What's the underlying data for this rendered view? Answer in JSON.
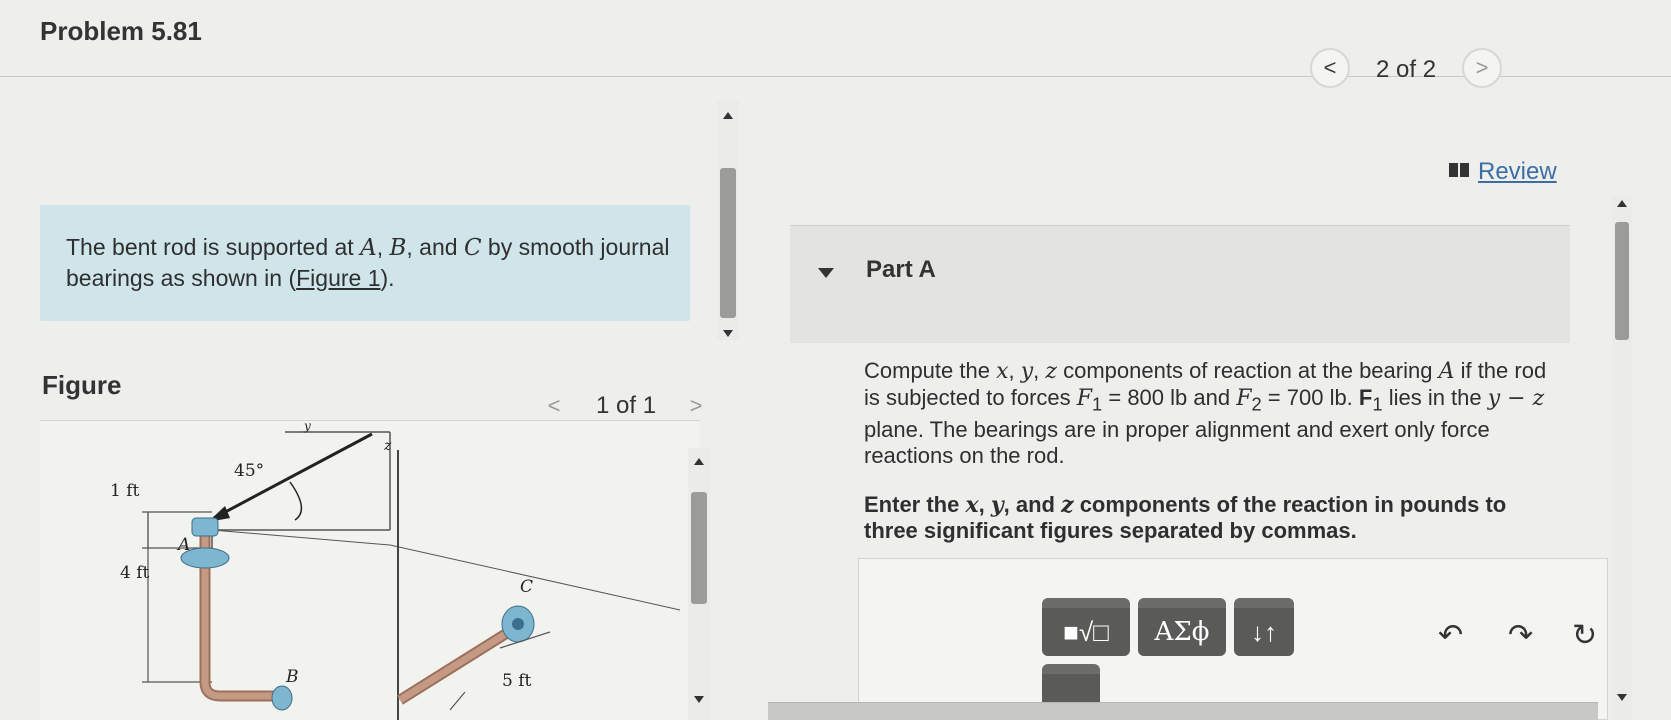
{
  "header": {
    "title": "Problem 5.81",
    "pager": {
      "prev": "<",
      "text": "2 of 2",
      "next": ">"
    },
    "review_label": "Review"
  },
  "intro": {
    "text_before": "The bent rod is supported at ",
    "A": "A",
    "comma1": ", ",
    "B": "B",
    "text_and": ", and ",
    "C": "C",
    "text_after": " by smooth journal bearings as shown in (",
    "figure_link": "Figure 1",
    "text_end": ")."
  },
  "figure": {
    "label": "Figure",
    "pager": {
      "prev": "<",
      "text": "1 of 1",
      "next": ">"
    },
    "labels": {
      "dim_1ft": "1 ft",
      "dim_4ft": "4 ft",
      "angle": "45°",
      "point_a": "A",
      "point_b": "B",
      "point_c": "C",
      "dim_5ft": "5 ft",
      "axis_z": "z",
      "axis_y": "y"
    }
  },
  "part": {
    "label": "Part A",
    "problem": {
      "t1": "Compute the ",
      "x": "x",
      "c1": ", ",
      "y": "y",
      "c2": ", ",
      "z": "z",
      "t2": " components of reaction at the bearing ",
      "A": "A",
      "t3": " if the rod is subjected to forces ",
      "F1": "F",
      "F1sub": "1",
      "t4": " = 800 lb and ",
      "F2": "F",
      "F2sub": "2",
      "t5": " = 700 lb. ",
      "F1b": "F",
      "F1bsub": "1",
      "t6": " lies in the ",
      "plane": "y − z",
      "t7": " plane. The bearings are in proper alignment and exert only force reactions on the rod."
    },
    "instruction": {
      "t1": "Enter the ",
      "x": "x",
      "c1": ", ",
      "y": "y",
      "t2": ", and ",
      "z": "z",
      "t3": " components of the reaction in pounds to three significant figures separated by commas."
    },
    "toolbar": {
      "templates": "■√□",
      "symbols": "ΑΣϕ",
      "vector": "↓↑",
      "undo": "↶",
      "redo": "↷",
      "reset": "↻"
    }
  },
  "colors": {
    "intro_bg": "#cfe5e9",
    "link": "#3b6ea5",
    "tool_btn": "#5a5a58",
    "rod": "#c49a84",
    "bearing": "#7fb6cf"
  }
}
